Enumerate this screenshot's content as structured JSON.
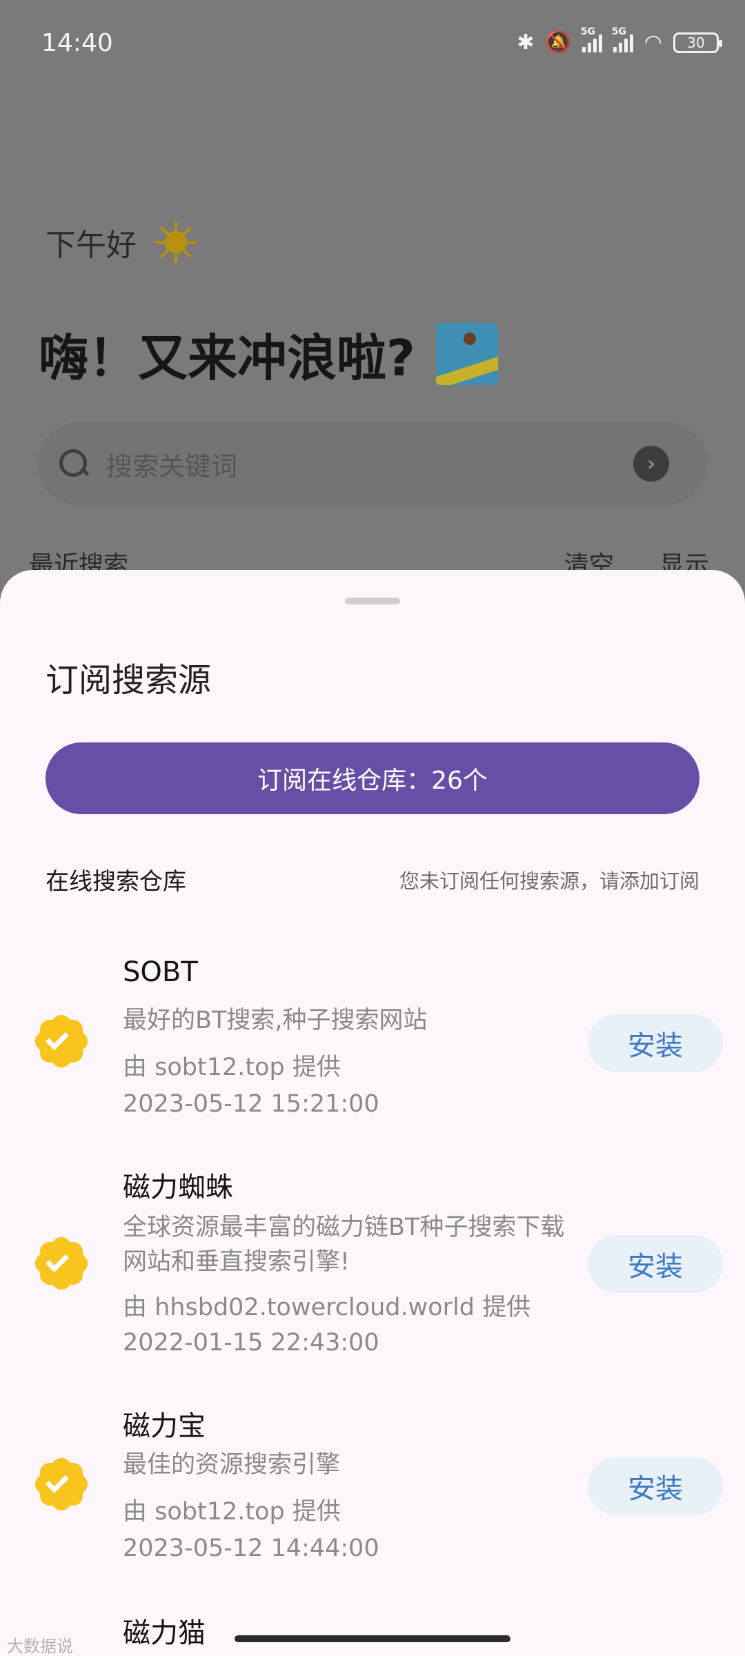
{
  "status_bar": {
    "time": "14:40",
    "network_1": "5G",
    "network_2": "5G",
    "battery": "30"
  },
  "background_page": {
    "greeting": "下午好",
    "headline": "嗨！又来冲浪啦?",
    "search_placeholder": "搜索关键词",
    "recent_title": "最近搜索",
    "recent_clear": "清空",
    "recent_show": "显示"
  },
  "sheet": {
    "title": "订阅搜索源",
    "subscribe_button": "订阅在线仓库：26个",
    "repo_label": "在线搜索仓库",
    "repo_note": "您未订阅任何搜索源，请添加订阅",
    "items": [
      {
        "name": "SOBT",
        "description": "最好的BT搜索,种子搜索网站",
        "provider": "由 sobt12.top 提供",
        "date": "2023-05-12 15:21:00",
        "action": "安装"
      },
      {
        "name": "磁力蜘蛛",
        "description": "全球资源最丰富的磁力链BT种子搜索下载网站和垂直搜索引擎!",
        "provider": "由 hhsbd02.towercloud.world 提供",
        "date": "2022-01-15 22:43:00",
        "action": "安装"
      },
      {
        "name": "磁力宝",
        "description": "最佳的资源搜索引擎",
        "provider": "由 sobt12.top 提供",
        "date": "2023-05-12 14:44:00",
        "action": "安装"
      },
      {
        "name": "磁力猫"
      }
    ]
  },
  "watermark": "大数据说"
}
